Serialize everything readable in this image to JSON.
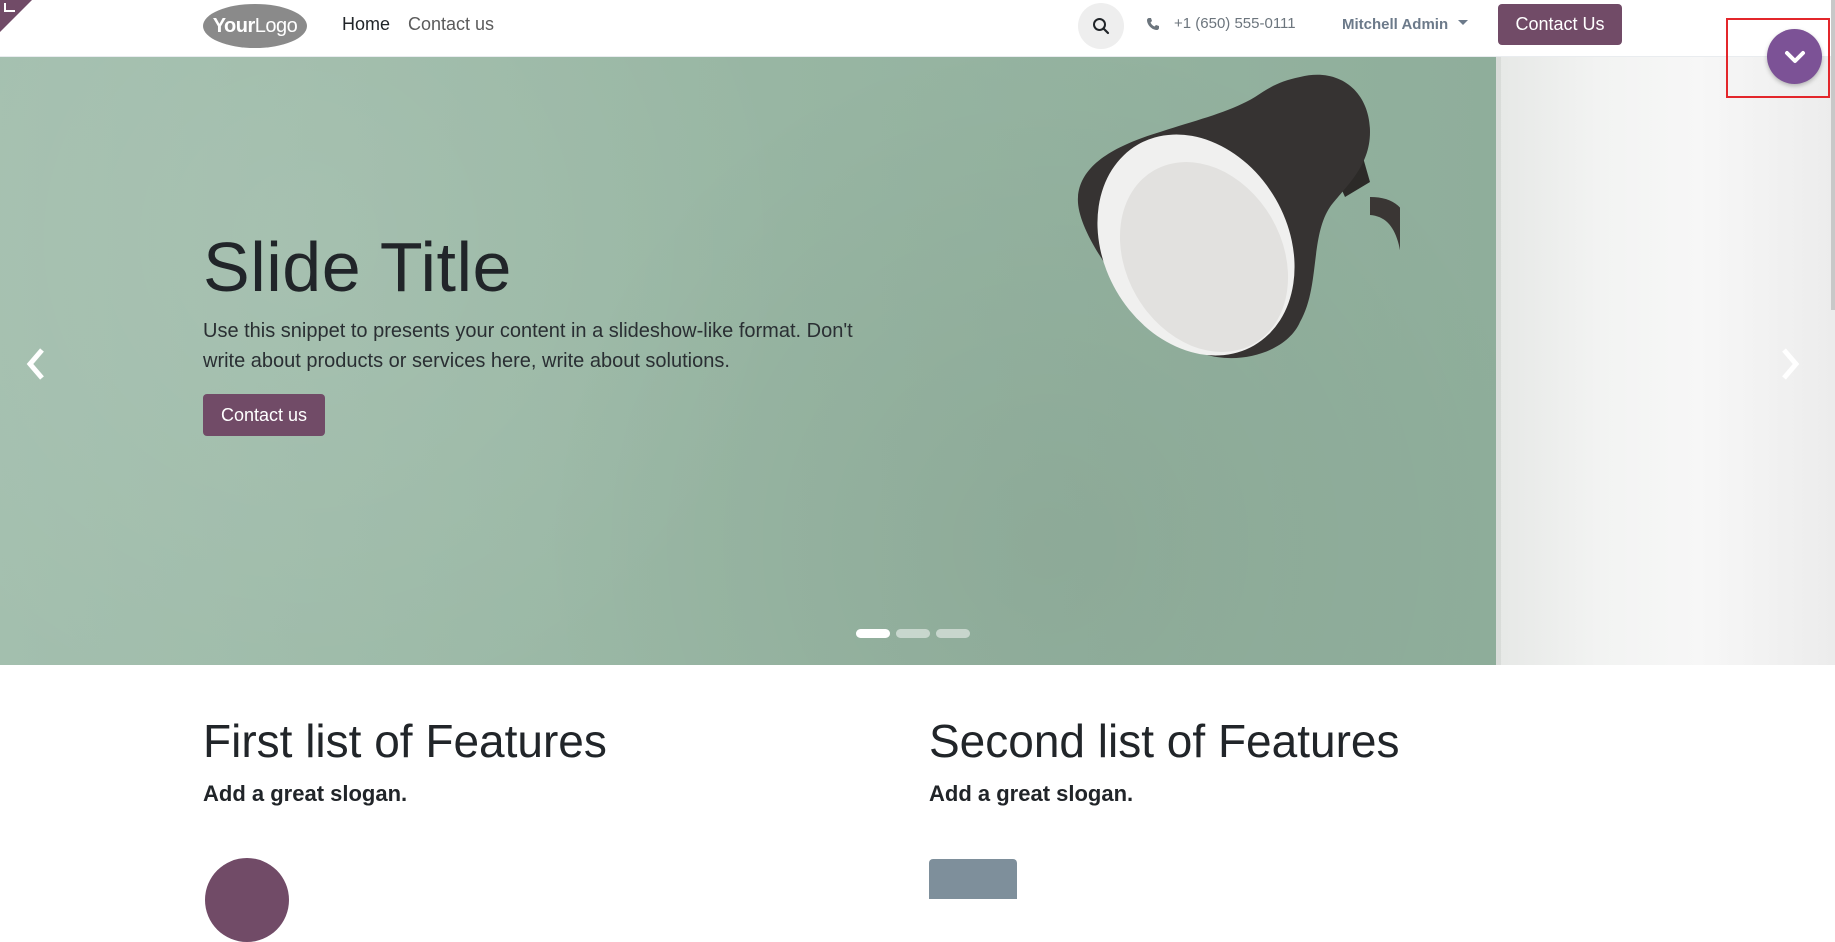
{
  "header": {
    "logo_text": "YourLogo",
    "nav": [
      {
        "label": "Home"
      },
      {
        "label": "Contact us"
      }
    ],
    "phone": "+1 (650) 555-0111",
    "user": "Mitchell Admin",
    "cta_label": "Contact Us"
  },
  "hero": {
    "title": "Slide Title",
    "text": "Use this snippet to presents your content in a slideshow-like format. Don't write about products or services here, write about solutions.",
    "button_label": "Contact us",
    "indicators": {
      "count": 3,
      "active": 1
    }
  },
  "features": {
    "first": {
      "title": "First list of Features",
      "slogan": "Add a great slogan."
    },
    "second": {
      "title": "Second list of Features",
      "slogan": "Add a great slogan."
    }
  },
  "colors": {
    "brand": "#714b67",
    "float_button": "#7c5296",
    "highlight": "#e3262b"
  },
  "icons": {
    "search": "search-icon",
    "phone": "phone-icon",
    "caret": "caret-down-icon",
    "prev": "chevron-left-icon",
    "next": "chevron-right-icon",
    "float": "chevron-down-icon"
  }
}
